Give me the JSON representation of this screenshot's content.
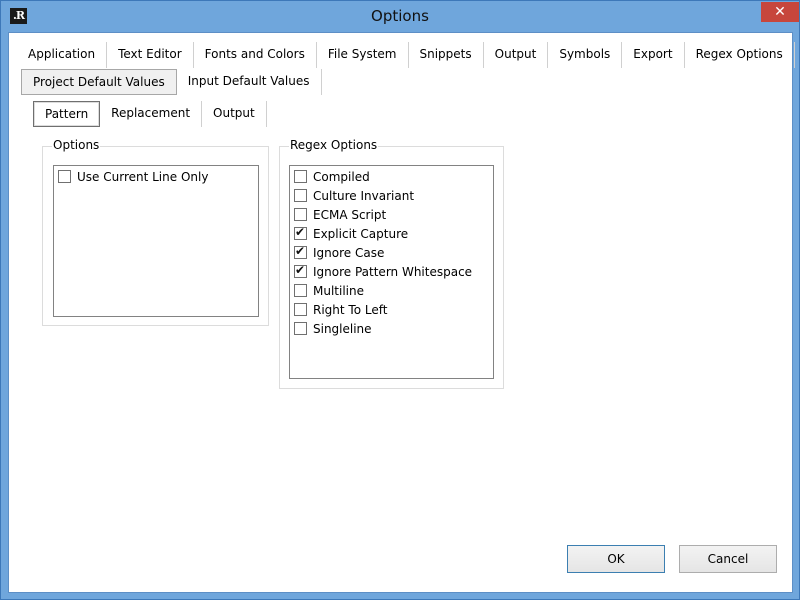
{
  "window": {
    "title": "Options",
    "logo": ".R",
    "close_glyph": "✕"
  },
  "main_tabs_row1": [
    "Application",
    "Text Editor",
    "Fonts and Colors",
    "File System",
    "Snippets",
    "Output",
    "Symbols",
    "Export",
    "Regex Options"
  ],
  "main_tabs_row2": [
    "Project Default Values",
    "Input Default Values"
  ],
  "sub_tabs": [
    "Pattern",
    "Replacement",
    "Output"
  ],
  "options_group": {
    "label": "Options",
    "items": [
      {
        "label": "Use Current Line Only",
        "checked": false
      }
    ]
  },
  "regex_group": {
    "label": "Regex Options",
    "items": [
      {
        "label": "Compiled",
        "checked": false
      },
      {
        "label": "Culture Invariant",
        "checked": false
      },
      {
        "label": "ECMA Script",
        "checked": false
      },
      {
        "label": "Explicit Capture",
        "checked": true
      },
      {
        "label": "Ignore Case",
        "checked": true
      },
      {
        "label": "Ignore Pattern Whitespace",
        "checked": true
      },
      {
        "label": "Multiline",
        "checked": false
      },
      {
        "label": "Right To Left",
        "checked": false
      },
      {
        "label": "Singleline",
        "checked": false
      }
    ]
  },
  "buttons": {
    "ok": "OK",
    "cancel": "Cancel"
  }
}
